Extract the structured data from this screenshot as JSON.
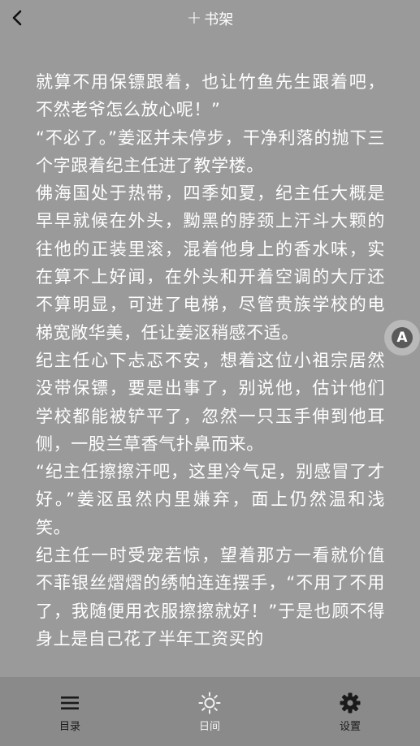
{
  "header": {
    "back_icon": "chevron-left-icon",
    "bookshelf_plus": "+",
    "bookshelf_label": "书架"
  },
  "content": {
    "paragraphs": [
      "就算不用保镖跟着，也让竹鱼先生跟着吧，不然老爷怎么放心呢！”",
      "“不必了。”姜沤并未停步，干净利落的抛下三个字跟着纪主任进了教学楼。",
      "佛海国处于热带，四季如夏，纪主任大概是早早就候在外头，黝黑的脖颈上汗斗大颗的往他的正装里滚，混着他身上的香水味，实在算不上好闻，在外头和开着空调的大厅还不算明显，可进了电梯，尽管贵族学校的电梯宽敞华美，任让姜沤稍感不适。",
      "纪主任心下忐忑不安，想着这位小祖宗居然没带保镖，要是出事了，别说他，估计他们学校都能被铲平了，忽然一只玉手伸到他耳侧，一股兰草香气扑鼻而来。",
      "“纪主任擦擦汗吧，这里冷气足，别感冒了才好。”姜沤虽然内里嫌弃，面上仍然温和浅笑。",
      "纪主任一时受宠若惊，望着那方一看就价值不菲银丝熠熠的绣帕连连摆手，“不用了不用了，我随便用衣服擦擦就好！”于是也顾不得身上是自己花了半年工资买的"
    ]
  },
  "floating": {
    "font_toggle_label": "A"
  },
  "footer": {
    "toc_label": "目录",
    "toc_icon": "menu-icon",
    "day_label": "日间",
    "day_icon": "sun-icon",
    "settings_label": "设置",
    "settings_icon": "gear-icon"
  },
  "colors": {
    "background": "#9a9a9a",
    "bottom_bar": "#8a8a8a",
    "text": "#ffffff",
    "tab_text": "#1a1a1a"
  }
}
